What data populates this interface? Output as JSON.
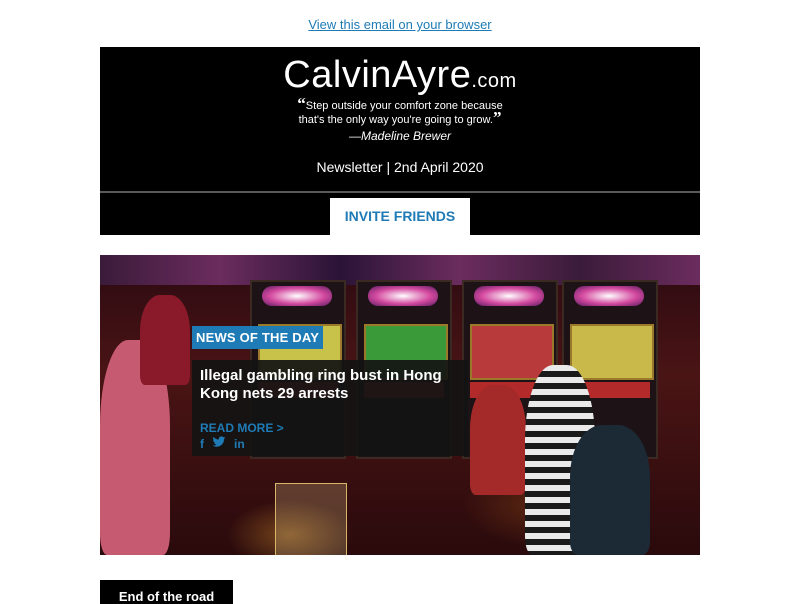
{
  "top_link": "View this email on your browser",
  "header": {
    "logo_main": "CalvinAyre",
    "logo_suffix": ".com",
    "quote_line1": "Step outside your comfort zone because",
    "quote_line2": "that's the only way you're going to grow.",
    "quote_author": "—Madeline Brewer",
    "dateline": "Newsletter | 2nd April 2020",
    "invite_label": "INVITE FRIENDS"
  },
  "hero": {
    "tag": "NEWS OF THE DAY",
    "title": "Illegal gambling ring bust in Hong Kong nets 29 arrests",
    "read_more": "READ MORE >",
    "social": [
      "f",
      "t",
      "in"
    ]
  },
  "section": {
    "title": "End of the road"
  },
  "colors": {
    "accent": "#1f7bb6",
    "header_bg": "#000000",
    "card_bg": "#141414"
  }
}
